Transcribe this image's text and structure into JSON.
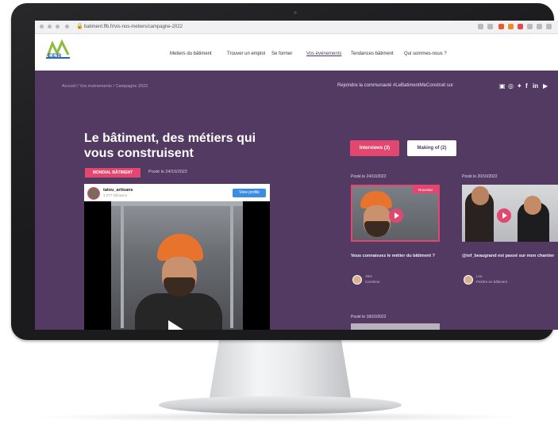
{
  "browser": {
    "url": "batiment.ffb.fr/vis-nos-metiers/campagne-2022"
  },
  "site": {
    "logo_text": "FFB",
    "nav": [
      "Metiers du bâtiment",
      "Trouver un emploi",
      "Se former",
      "Vos événements",
      "Tendances bâtiment",
      "Qui sommes-nous ?"
    ]
  },
  "page": {
    "breadcrumb": "Accueil / Vos événements / Campagne 2022",
    "community": "Rejoindre la communauté #LeBatimentMeConstruit sur",
    "social_icons": [
      "facebook-icon",
      "instagram-icon",
      "twitter-icon",
      "facebook-square-icon",
      "linkedin-icon",
      "youtube-icon"
    ],
    "title_line1": "Le bâtiment, des métiers qui",
    "title_line2": "vous construisent",
    "badge": "MONDIAL BÂTIMENT",
    "posted": "Posté le 24/10/2022",
    "embed": {
      "username": "tatou_artisans",
      "followers": "1,077 followers",
      "view_profile": "View profile"
    }
  },
  "cards": {
    "tabs": [
      "Interviews (3)",
      "Making of (2)"
    ],
    "items": [
      {
        "date": "Posté le 24/10/2022",
        "badge": "Nouveau",
        "caption": "Vous connaissez le métier du bâtiment ?",
        "author": "Alex",
        "author_sub": "Carreleur"
      },
      {
        "date": "Posté le 20/10/2022",
        "caption": "@tof_beaugrand est passé sur mon chantier",
        "author": "Lou",
        "author_sub": "Peintre en bâtiment"
      },
      {
        "date": "Posté le 18/10/2022"
      }
    ]
  },
  "colors": {
    "brand_purple": "#523a62",
    "accent_pink": "#e3466f"
  }
}
